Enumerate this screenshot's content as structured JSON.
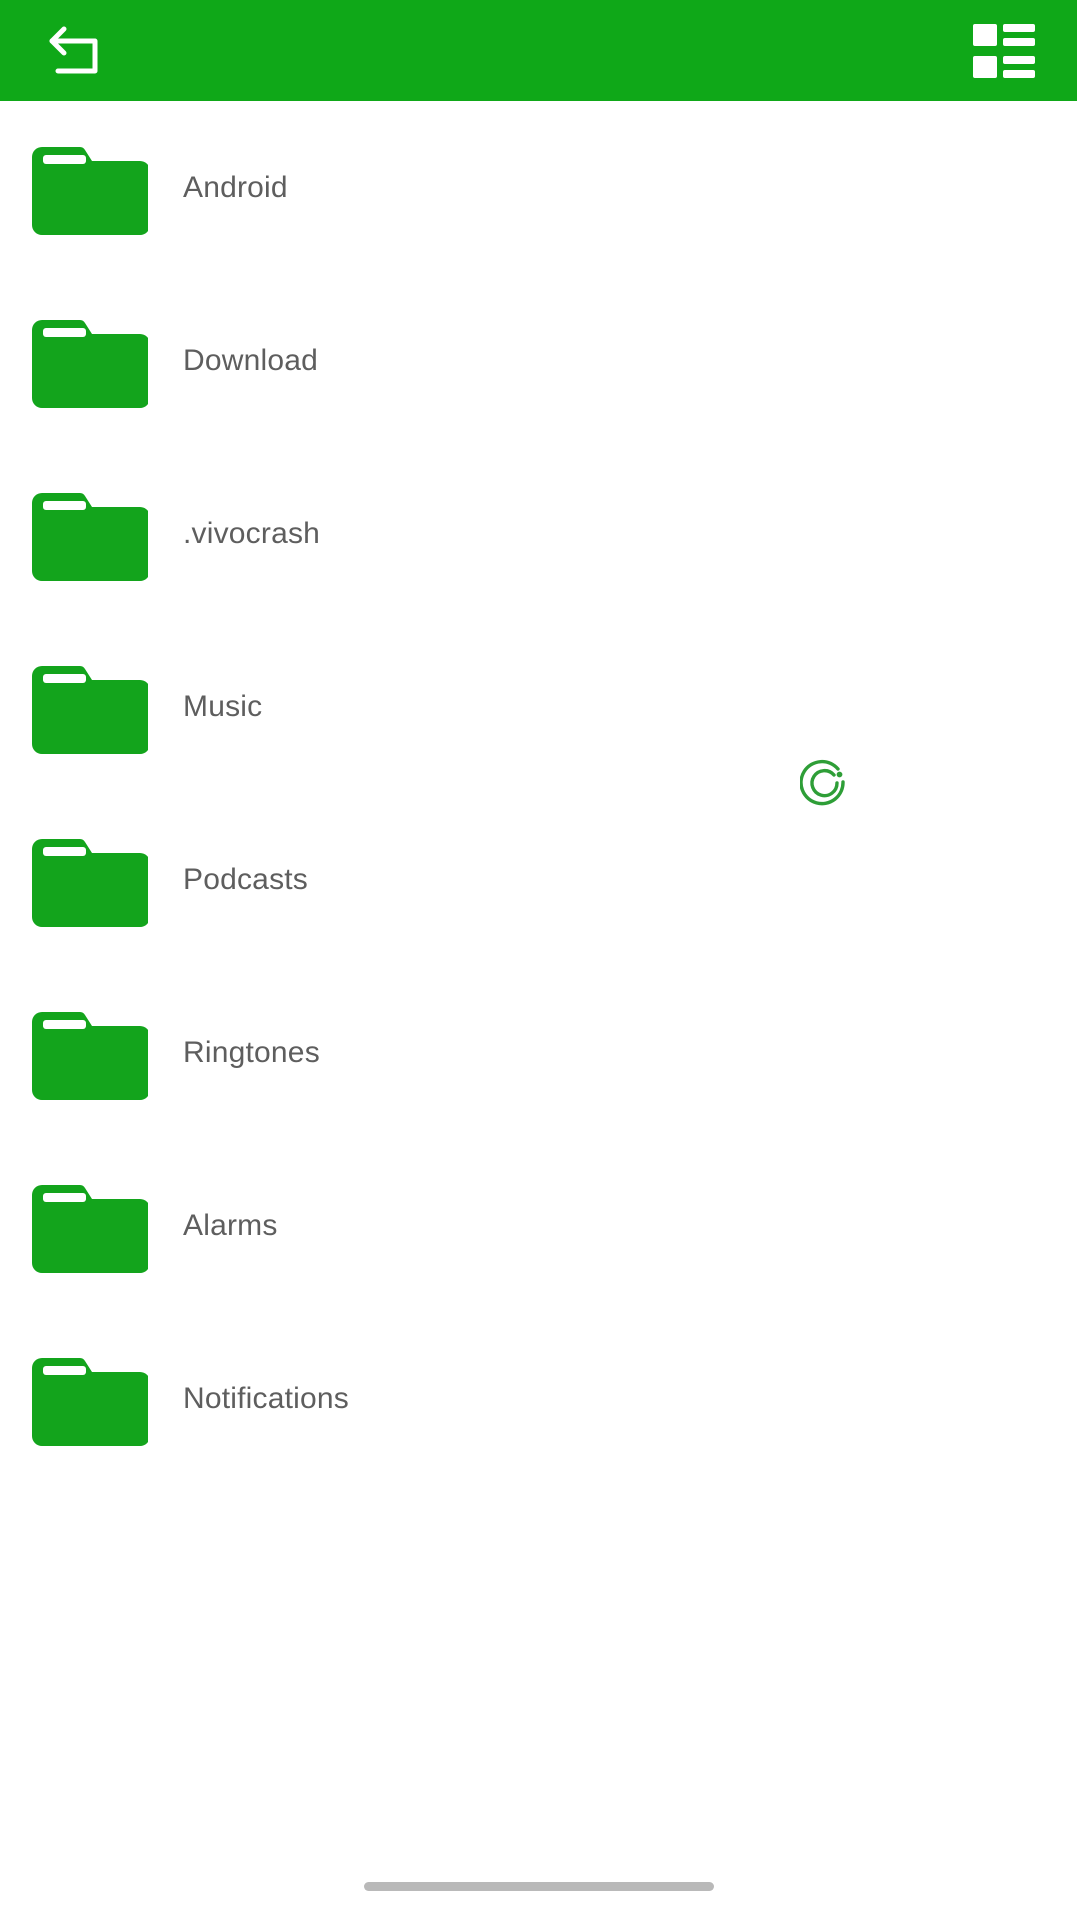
{
  "app": {
    "screen_name": "file-browser",
    "accent_color": "#0FA818",
    "folder_icon_color": "#13A41C",
    "label_color": "#5E5E5E",
    "background_color": "#FFFFFF"
  },
  "header": {
    "back_button_label": "",
    "back_icon": "return-arrow-icon",
    "view_toggle_label": "",
    "view_toggle_icon": "list-view-icon"
  },
  "actions": {
    "refresh_label": "",
    "refresh_icon": "refresh-circle-icon",
    "refresh_color": "#2E9E37"
  },
  "files": {
    "items": [
      {
        "name": "Android",
        "icon": "folder-icon",
        "type": "folder"
      },
      {
        "name": "Download",
        "icon": "folder-icon",
        "type": "folder"
      },
      {
        "name": ".vivocrash",
        "icon": "folder-icon",
        "type": "folder"
      },
      {
        "name": "Music",
        "icon": "folder-icon",
        "type": "folder"
      },
      {
        "name": "Podcasts",
        "icon": "folder-icon",
        "type": "folder"
      },
      {
        "name": "Ringtones",
        "icon": "folder-icon",
        "type": "folder"
      },
      {
        "name": "Alarms",
        "icon": "folder-icon",
        "type": "folder"
      },
      {
        "name": "Notifications",
        "icon": "folder-icon",
        "type": "folder"
      }
    ]
  },
  "system": {
    "home_indicator": ""
  }
}
